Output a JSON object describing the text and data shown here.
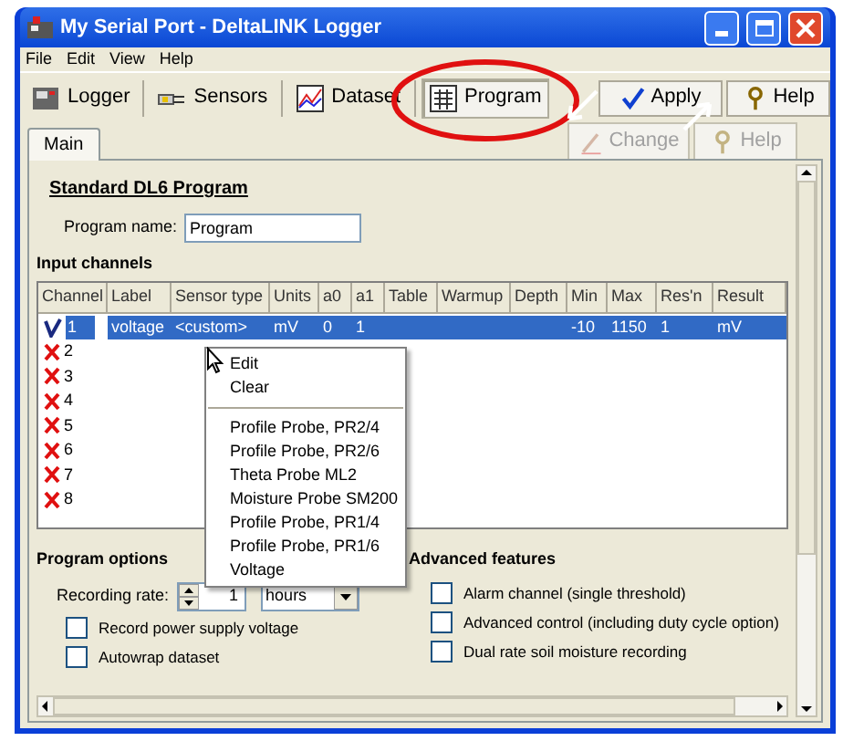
{
  "window": {
    "title": "My Serial Port - DeltaLINK Logger"
  },
  "menu": [
    "File",
    "Edit",
    "View",
    "Help"
  ],
  "toolbar": [
    {
      "label": "Logger",
      "kind": "logger",
      "selected": false
    },
    {
      "label": "Sensors",
      "kind": "sensors",
      "selected": false
    },
    {
      "label": "Dataset",
      "kind": "dataset",
      "selected": false
    },
    {
      "label": "Program",
      "kind": "program",
      "selected": true
    }
  ],
  "top_actions": [
    {
      "label": "Apply",
      "kind": "apply",
      "disabled": false
    },
    {
      "label": "Help",
      "kind": "help",
      "disabled": false
    }
  ],
  "edit_actions": [
    {
      "label": "Change",
      "kind": "change",
      "disabled": true
    },
    {
      "label": "Help",
      "kind": "help",
      "disabled": true
    }
  ],
  "tabs": [
    {
      "label": "Main",
      "selected": true
    }
  ],
  "program": {
    "heading": "Standard DL6 Program",
    "name_label": "Program name:",
    "name_value": "Program"
  },
  "input_channels": {
    "title": "Input channels",
    "columns": [
      "Channel",
      "Label",
      "Sensor type",
      "Units",
      "a0",
      "a1",
      "Table",
      "Warmup",
      "Depth",
      "Min",
      "Max",
      "Res'n",
      "Result"
    ],
    "rows": [
      {
        "kind": "configured",
        "selected": true,
        "cells": [
          "1",
          "voltage",
          "<custom>",
          "mV",
          "0",
          "1",
          null,
          null,
          null,
          "-10",
          "1150",
          "1",
          "mV"
        ]
      },
      {
        "kind": "empty",
        "selected": false,
        "cells": [
          "2"
        ]
      },
      {
        "kind": "empty",
        "selected": false,
        "cells": [
          "3"
        ]
      },
      {
        "kind": "empty",
        "selected": false,
        "cells": [
          "4"
        ]
      },
      {
        "kind": "empty",
        "selected": false,
        "cells": [
          "5"
        ]
      },
      {
        "kind": "empty",
        "selected": false,
        "cells": [
          "6"
        ]
      },
      {
        "kind": "empty",
        "selected": false,
        "cells": [
          "7"
        ]
      },
      {
        "kind": "empty",
        "selected": false,
        "cells": [
          "8"
        ]
      }
    ]
  },
  "context_menu": {
    "sections": [
      [
        "Edit",
        "Clear"
      ],
      [
        "Profile Probe, PR2/4",
        "Profile Probe, PR2/6",
        "Theta Probe ML2",
        "Moisture Probe SM200",
        "Profile Probe, PR1/4",
        "Profile Probe, PR1/6",
        "Voltage"
      ]
    ]
  },
  "program_options": {
    "title": "Program options",
    "rate_label": "Recording rate:",
    "rate_value": "1",
    "rate_unit": "hours",
    "checkboxes": [
      {
        "label": "Record power supply voltage",
        "checked": false
      },
      {
        "label": "Autowrap dataset",
        "checked": false
      }
    ]
  },
  "advanced_features": {
    "title": "Advanced features",
    "checkboxes": [
      {
        "label": "Alarm channel (single threshold)",
        "checked": false
      },
      {
        "label": "Advanced control (including duty cycle option)",
        "checked": false
      },
      {
        "label": "Dual rate soil moisture recording",
        "checked": false
      }
    ]
  }
}
